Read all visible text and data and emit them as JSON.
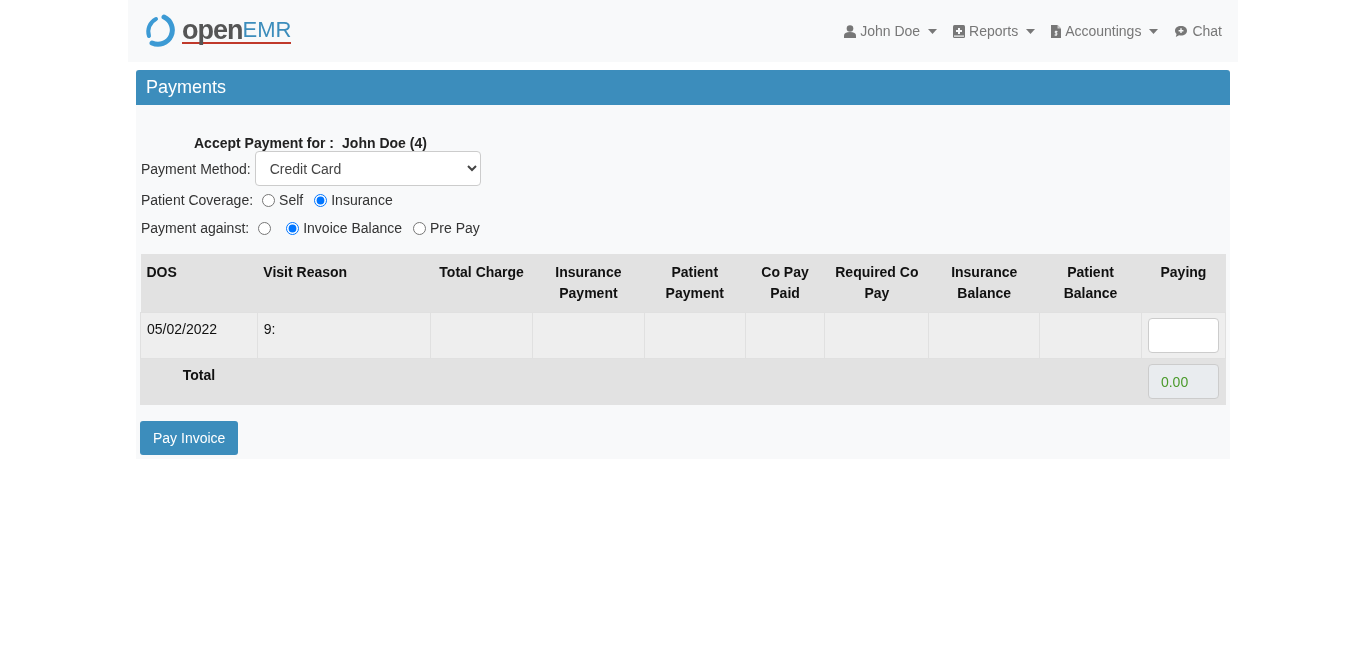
{
  "navbar": {
    "logo": {
      "part_1": "open",
      "part_2": "EMR"
    },
    "menu": [
      {
        "label": "John Doe",
        "kind": "user",
        "dropdown": true
      },
      {
        "label": "Reports",
        "kind": "reports",
        "dropdown": true
      },
      {
        "label": "Accountings",
        "kind": "accounting",
        "dropdown": true
      },
      {
        "label": "Chat",
        "kind": "chat",
        "dropdown": false
      }
    ]
  },
  "panel": {
    "title": "Payments",
    "accept_label": "Accept Payment for :",
    "patient": "John Doe (4)",
    "payment_method": {
      "label": "Payment Method:",
      "value": "Credit Card"
    },
    "radio_groups": [
      {
        "label": "Patient Coverage:",
        "options": [
          {
            "label": "Self",
            "selected": false
          },
          {
            "label": "Insurance",
            "selected": true
          }
        ]
      },
      {
        "label": "Payment against:",
        "options": [
          {
            "selected": false
          },
          {
            "label": "Invoice Balance",
            "selected": true
          },
          {
            "label": "Pre Pay",
            "selected": false
          }
        ]
      }
    ],
    "table": {
      "columns": [
        "DOS",
        "Visit Reason",
        "Total Charge",
        "Insurance Payment",
        "Patient Payment",
        "Co Pay Paid",
        "Required Co Pay",
        "Insurance Balance",
        "Patient Balance",
        "Paying"
      ],
      "rows": [
        {
          "dos": "05/02/2022",
          "visit_reason": "9:"
        }
      ],
      "total": {
        "label": "Total",
        "value": "0.00"
      }
    },
    "button": "Pay Invoice"
  }
}
